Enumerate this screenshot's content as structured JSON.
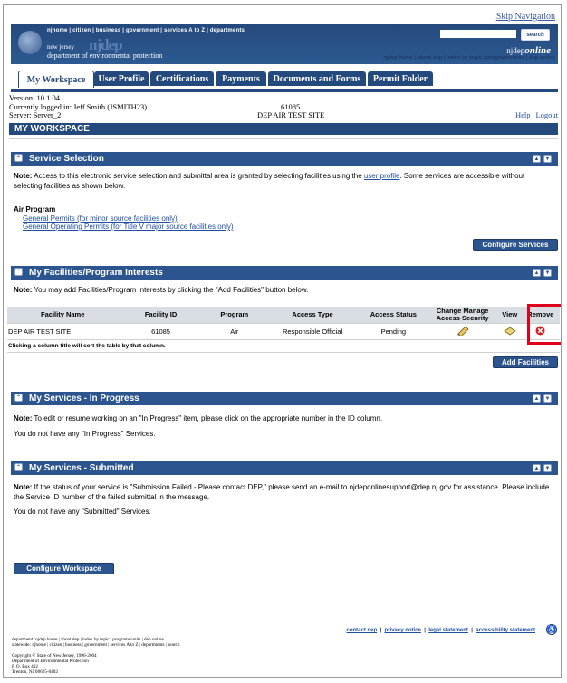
{
  "header": {
    "skip_nav": "Skip Navigation",
    "top_nav": "njhome  |  citizen  |  business  |  government  |  services A to Z  |  departments",
    "nj_sub": "new jersey",
    "nj_big": "njdep",
    "dept_name": "department of environmental protection",
    "search_label": "search",
    "search_placeholder": "",
    "online_prefix": "njdep",
    "online_suffix": "online",
    "sub_nav": "njdep home  |  about dep  |  index by topic  |  programs/units  |  dep online"
  },
  "tabs": [
    {
      "label": "My Workspace"
    },
    {
      "label": "User Profile"
    },
    {
      "label": "Certifications"
    },
    {
      "label": "Payments"
    },
    {
      "label": "Documents and Forms"
    },
    {
      "label": "Permit Folder"
    }
  ],
  "info": {
    "version": "Version: 10.1.04",
    "logged_in": "Currently logged in:  Jeff Smith (JSMITH23)",
    "server": "Server: Server_2",
    "facility_id": "61085",
    "site_name": "DEP AIR TEST SITE",
    "help": "Help",
    "logout": "Logout"
  },
  "workspace_title": "MY WORKSPACE",
  "service_selection": {
    "title": "Service Selection",
    "note_label": "Note:",
    "note_text": " Access to this electronic service selection and submittal area is granted by selecting facilities using the ",
    "note_link": "user profile",
    "note_text2": ". Some services are accessible without selecting facilities as shown below.",
    "program_title": "Air Program",
    "link1": "General Permits (for minor source facilities only)",
    "link2": "General Operating Permits (for Title V major source facilities only)",
    "button": "Configure Services"
  },
  "facilities": {
    "title": "My Facilities/Program Interests",
    "note_label": "Note:",
    "note_text": " You may add Facilities/Program Interests by clicking the \"Add Facilities\" button below.",
    "columns": [
      "Facility Name",
      "Facility ID",
      "Program",
      "Access Type",
      "Access Status",
      "Change Manage Access Security",
      "View",
      "Remove"
    ],
    "rows": [
      {
        "name": "DEP AIR TEST SITE",
        "id": "61085",
        "program": "Air",
        "access_type": "Responsible Official",
        "status": "Pending"
      }
    ],
    "hint": "Clicking a column title will sort the table by that column.",
    "button": "Add Facilities"
  },
  "in_progress": {
    "title": "My Services - In Progress",
    "note_label": "Note:",
    "note_text": " To edit or resume working on an \"In Progress\" item, please click on the appropriate number in the ID column.",
    "empty": "You do not have any \"In Progress\" Services."
  },
  "submitted": {
    "title": "My Services - Submitted",
    "note_label": "Note:",
    "note_text": " If the status of your service is \"Submission Failed - Please contact DEP,\" please send an e-mail to njdeponlinesupport@dep.nj.gov for assistance. Please include the Service ID number of the failed submittal in the message.",
    "empty": "You do not have any \"Submitted\" Services."
  },
  "configure_workspace": "Configure Workspace",
  "footer": {
    "links": [
      "contact dep",
      "privacy notice",
      "legal statement",
      "accessibility statement"
    ],
    "dept_line": "department: njdep home | about dep | index by topic | programs/units | dep online",
    "statewide_line": "statewide: njhome | citizen | business | government | services A to Z | departments | search",
    "copyright": "Copyright © State of New Jersey, 1996-2004",
    "addr1": "Department of Environmental Protection",
    "addr2": "P. O. Box 402",
    "addr3": "Trenton, NJ 08625-0402"
  },
  "colors": {
    "primary": "#24497c",
    "section": "#2c5590",
    "highlight": "#e0001b",
    "remove_icon": "#d32020"
  }
}
